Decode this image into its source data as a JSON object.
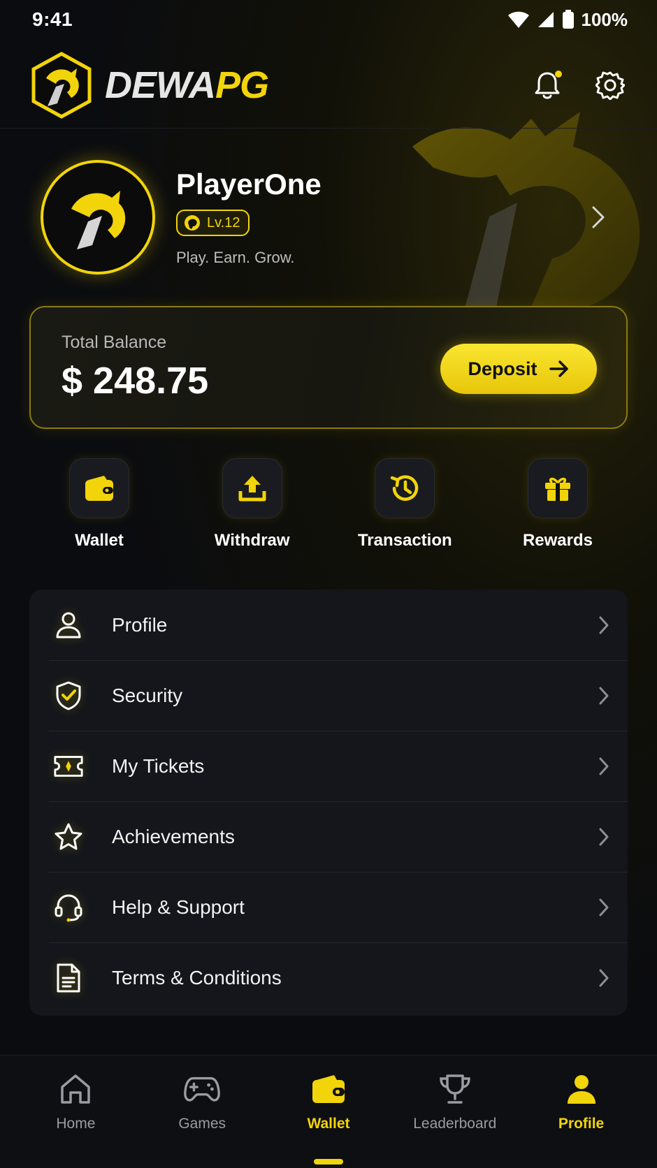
{
  "status_bar": {
    "time": "9:41",
    "battery": "100%"
  },
  "header": {
    "brand_part1": "DEWA",
    "brand_part2": "PG"
  },
  "profile": {
    "name": "PlayerOne",
    "level": "Lv.12",
    "tagline": "Play. Earn. Grow."
  },
  "balance": {
    "label": "Total Balance",
    "amount": "$ 248.75",
    "deposit_label": "Deposit"
  },
  "quick_actions": [
    {
      "label": "Wallet",
      "icon": "wallet-icon"
    },
    {
      "label": "Withdraw",
      "icon": "withdraw-icon"
    },
    {
      "label": "Transaction",
      "icon": "history-icon"
    },
    {
      "label": "Rewards",
      "icon": "gift-icon"
    }
  ],
  "menu": [
    {
      "label": "Profile",
      "icon": "user-icon"
    },
    {
      "label": "Security",
      "icon": "shield-check-icon"
    },
    {
      "label": "My Tickets",
      "icon": "ticket-icon"
    },
    {
      "label": "Achievements",
      "icon": "star-icon"
    },
    {
      "label": "Help & Support",
      "icon": "headset-icon"
    },
    {
      "label": "Terms & Conditions",
      "icon": "document-icon"
    }
  ],
  "bottom_nav": [
    {
      "label": "Home",
      "icon": "home-icon"
    },
    {
      "label": "Games",
      "icon": "gamepad-icon"
    },
    {
      "label": "Wallet",
      "icon": "wallet-icon",
      "active": true
    },
    {
      "label": "Leaderboard",
      "icon": "trophy-icon"
    },
    {
      "label": "Profile",
      "icon": "user-icon",
      "active": true
    }
  ],
  "colors": {
    "accent": "#f2d40a",
    "background": "#0b0c0f",
    "card": "#14161b",
    "muted": "#9a9ca3"
  }
}
